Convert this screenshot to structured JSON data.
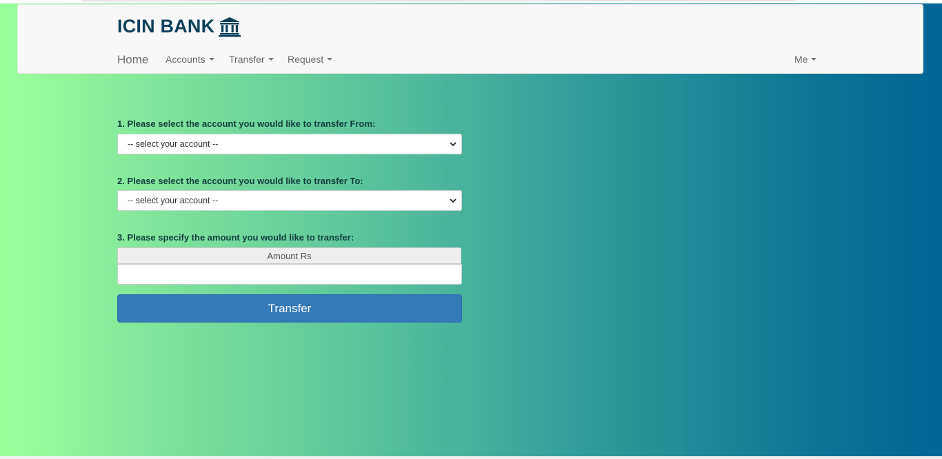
{
  "brand": {
    "title": "ICIN BANK",
    "icon": "bank-building-icon"
  },
  "nav": {
    "home": "Home",
    "accounts": "Accounts",
    "transfer": "Transfer",
    "request": "Request",
    "me": "Me"
  },
  "form": {
    "from_label": "1. Please select the account you would like to transfer From:",
    "from_select": "-- select your account --",
    "to_label": "2. Please select the account you would like to transfer To:",
    "to_select": "-- select your account --",
    "amount_label": "3. Please specify the amount you would like to transfer:",
    "amount_addon": "Amount Rs",
    "amount_value": "",
    "submit_label": "Transfer"
  },
  "colors": {
    "brand_text": "#0d3f5a",
    "button": "#337ab7",
    "gradient_start": "#99ff99",
    "gradient_end": "#036697"
  }
}
